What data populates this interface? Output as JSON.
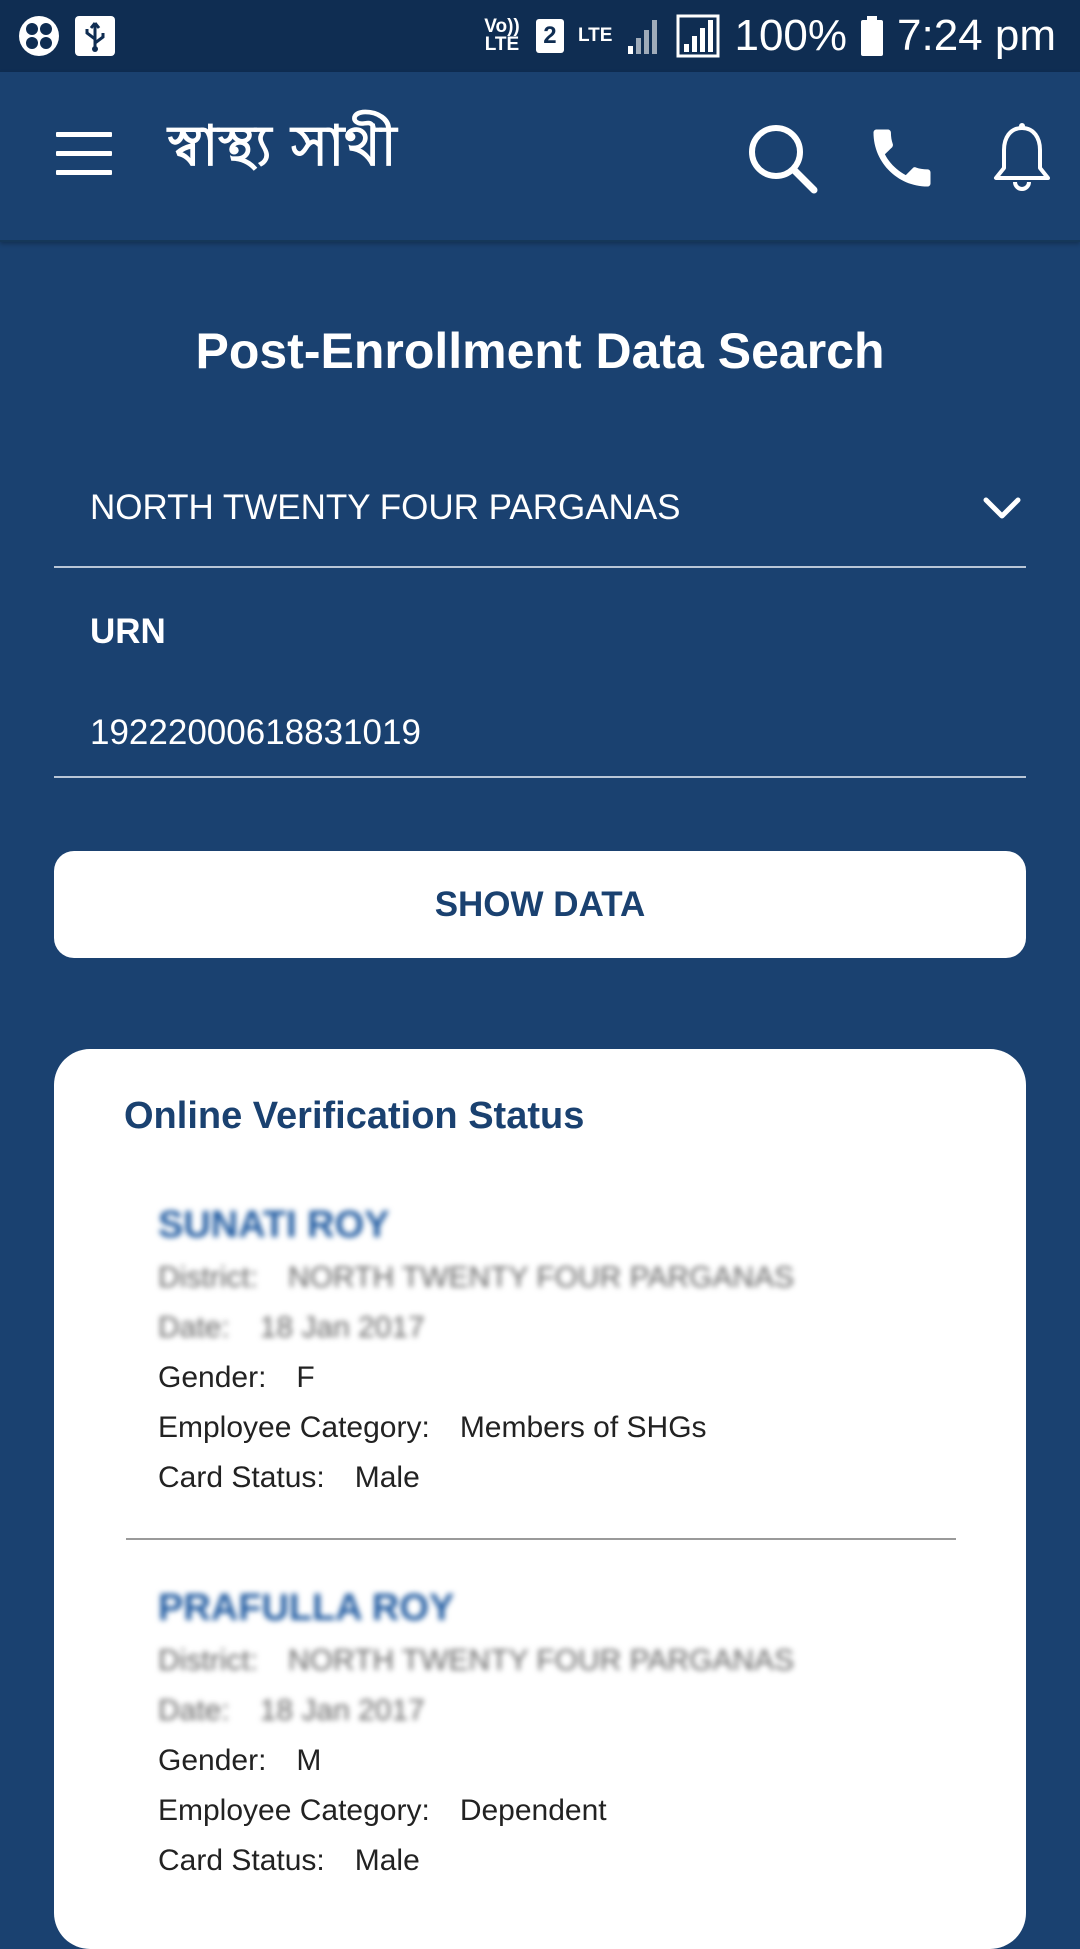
{
  "status_bar": {
    "volte_label": "Vo)) LTE",
    "sim_slot": "2",
    "network_label": "LTE",
    "battery_text": "100%",
    "time": "7:24 pm"
  },
  "app_bar": {
    "brand_text": "স্বাস্থ্য সাথী",
    "icons": [
      "menu-icon",
      "search-icon",
      "phone-icon",
      "bell-icon"
    ]
  },
  "page": {
    "title": "Post-Enrollment Data Search",
    "district_value": "NORTH TWENTY FOUR PARGANAS",
    "urn_label": "URN",
    "urn_value": "19222000618831019",
    "show_button_label": "SHOW DATA"
  },
  "results": {
    "title": "Online Verification Status",
    "records": [
      {
        "name": "SUNATI ROY",
        "district_label": "District:",
        "district_value": "NORTH TWENTY FOUR PARGANAS",
        "date_label": "Date:",
        "date_value": "18 Jan 2017",
        "gender_label": "Gender:",
        "gender_value": "F",
        "category_label": "Employee Category:",
        "category_value": "Members of SHGs",
        "card_label": "Card Status:",
        "card_value": "Male"
      },
      {
        "name": "PRAFULLA ROY",
        "district_label": "District:",
        "district_value": "NORTH TWENTY FOUR PARGANAS",
        "date_label": "Date:",
        "date_value": "18 Jan 2017",
        "gender_label": "Gender:",
        "gender_value": "M",
        "category_label": "Employee Category:",
        "category_value": "Dependent",
        "card_label": "Card Status:",
        "card_value": "Male"
      }
    ]
  },
  "colors": {
    "background": "#1a4170",
    "status_bar": "#0f2d52",
    "card": "#ffffff",
    "accent_text": "#1a4170"
  }
}
